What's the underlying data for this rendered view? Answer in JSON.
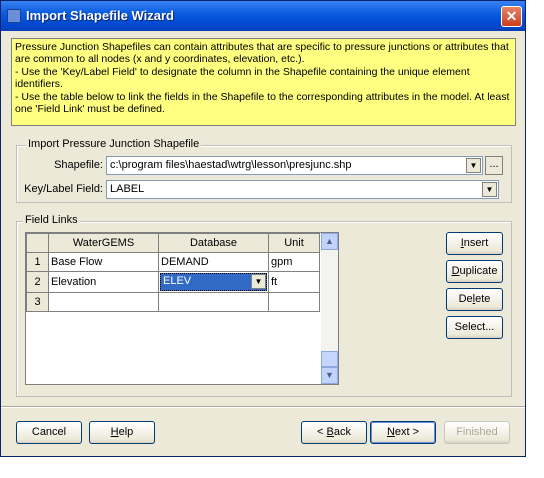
{
  "window": {
    "title": "Import Shapefile Wizard",
    "close_glyph": "✕"
  },
  "info": {
    "line1": "Pressure Junction Shapefiles can contain attributes that are specific to pressure junctions or attributes that are common to all nodes (x and y coordinates, elevation, etc.).",
    "line2": "- Use the 'Key/Label Field' to designate the column in the Shapefile containing the unique element identifiers.",
    "line3": "- Use the table below to link the fields in the Shapefile to the corresponding attributes in the model. At least one 'Field Link' must be defined."
  },
  "import_group": {
    "title": "Import Pressure Junction Shapefile",
    "shapefile_label": "Shapefile:",
    "shapefile_value": "c:\\program files\\haestad\\wtrg\\lesson\\presjunc.shp",
    "browse_label": "...",
    "key_label": "Key/Label Field:",
    "key_value": "LABEL"
  },
  "field_links": {
    "title": "Field Links",
    "columns": [
      "WaterGEMS",
      "Database",
      "Unit"
    ],
    "rows": [
      {
        "num": "1",
        "watergems": "Base Flow",
        "database": "DEMAND",
        "unit": "gpm"
      },
      {
        "num": "2",
        "watergems": "Elevation",
        "database": "ELEV",
        "unit": "ft"
      },
      {
        "num": "3",
        "watergems": "",
        "database": "",
        "unit": ""
      }
    ]
  },
  "side_buttons": {
    "insert_u": "I",
    "insert_rest": "nsert",
    "duplicate_u": "D",
    "duplicate_rest": "uplicate",
    "delete_pre": "De",
    "delete_u": "l",
    "delete_rest": "ete",
    "select": "Select..."
  },
  "footer": {
    "cancel": "Cancel",
    "help_u": "H",
    "help_rest": "elp",
    "back_pre": "< ",
    "back_u": "B",
    "back_rest": "ack",
    "next_u": "N",
    "next_rest": "ext >",
    "finished": "Finished"
  },
  "icons": {
    "dropdown": "chevron-down-icon",
    "scroll_up": "scroll-up-icon",
    "scroll_down": "scroll-down-icon"
  },
  "colors": {
    "title_bar": "#0a5ddf",
    "info_bg": "#ffff80",
    "selection": "#316ac5"
  }
}
